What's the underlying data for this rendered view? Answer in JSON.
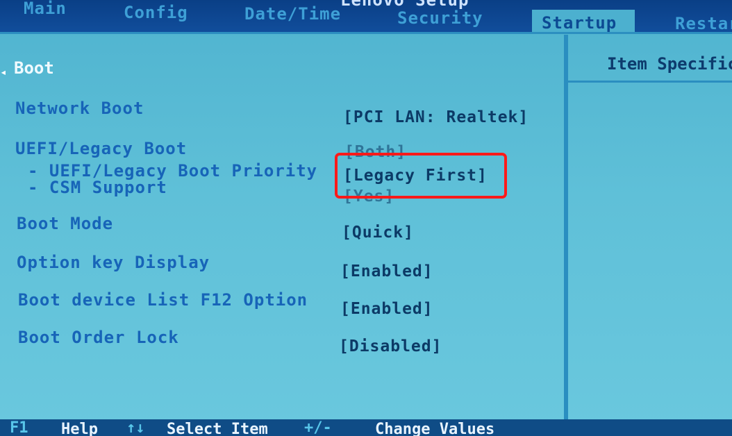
{
  "header": {
    "title": "Lenovo Setup",
    "tabs": [
      {
        "label": "Main",
        "active": false
      },
      {
        "label": "Config",
        "active": false
      },
      {
        "label": "Date/Time",
        "active": false
      },
      {
        "label": "Security",
        "active": false
      },
      {
        "label": "Startup",
        "active": true
      },
      {
        "label": "Restart",
        "active": false
      }
    ]
  },
  "section": {
    "title": "Boot"
  },
  "settings": [
    {
      "label": "Network Boot",
      "value": "[PCI LAN: Realtek]"
    },
    {
      "label": "UEFI/Legacy Boot",
      "value": "[Both]"
    },
    {
      "label": "- UEFI/Legacy Boot Priority",
      "value": "[Legacy First]"
    },
    {
      "label": "- CSM Support",
      "value": "[Yes]"
    },
    {
      "label": "Boot Mode",
      "value": "[Quick]"
    },
    {
      "label": "Option key Display",
      "value": "[Enabled]"
    },
    {
      "label": "Boot device List F12 Option",
      "value": "[Enabled]"
    },
    {
      "label": "Boot Order Lock",
      "value": "[Disabled]"
    }
  ],
  "help_panel": {
    "header": "Item Specific Help"
  },
  "footer": {
    "items": [
      {
        "key": "F1",
        "desc": "Help"
      },
      {
        "key": "↑↓",
        "desc": "Select Item"
      },
      {
        "key": "+/-",
        "desc": "Change Values"
      }
    ]
  },
  "colors": {
    "highlight": "#ff1a1a",
    "background": "#5fc0d8",
    "label": "#1764b8",
    "value": "#0c3a66"
  }
}
